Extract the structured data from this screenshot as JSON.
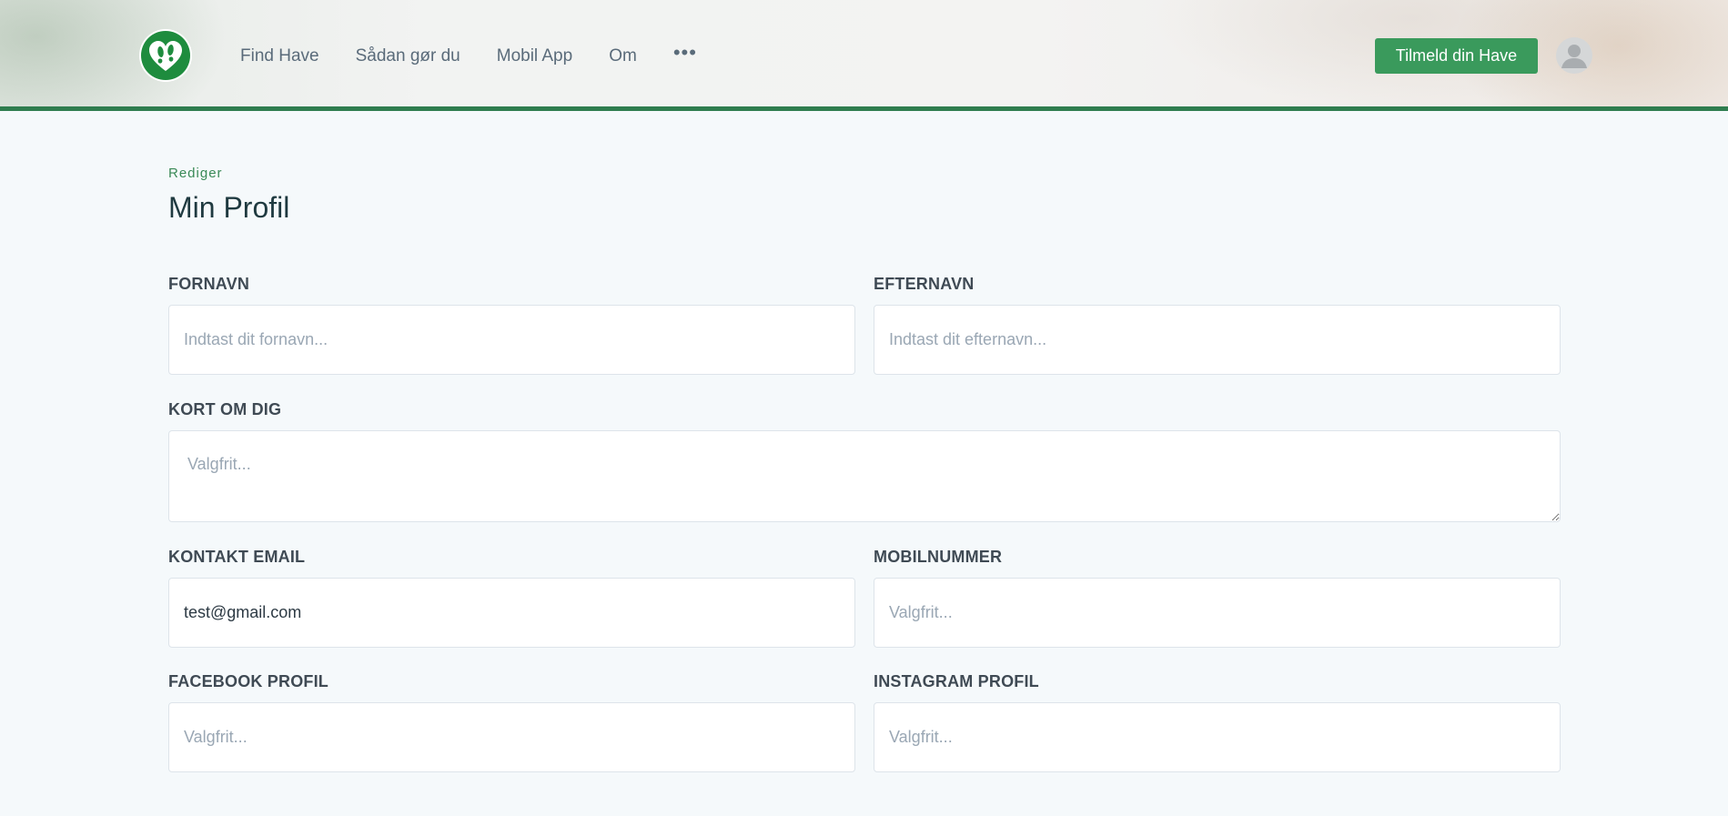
{
  "header": {
    "nav": [
      "Find Have",
      "Sådan gør du",
      "Mobil App",
      "Om"
    ],
    "more_label": "•••",
    "cta_label": "Tilmeld din Have"
  },
  "page": {
    "eyebrow": "Rediger",
    "title": "Min Profil"
  },
  "form": {
    "first_name": {
      "label": "FORNAVN",
      "value": "",
      "placeholder": "Indtast dit fornavn..."
    },
    "last_name": {
      "label": "EFTERNAVN",
      "value": "",
      "placeholder": "Indtast dit efternavn..."
    },
    "about": {
      "label": "KORT OM DIG",
      "value": "",
      "placeholder": "Valgfrit..."
    },
    "email": {
      "label": "KONTAKT EMAIL",
      "value": "test@gmail.com",
      "placeholder": ""
    },
    "mobile": {
      "label": "MOBILNUMMER",
      "value": "",
      "placeholder": "Valgfrit..."
    },
    "facebook": {
      "label": "FACEBOOK PROFIL",
      "value": "",
      "placeholder": "Valgfrit..."
    },
    "instagram": {
      "label": "INSTAGRAM PROFIL",
      "value": "",
      "placeholder": "Valgfrit..."
    }
  },
  "colors": {
    "brand": "#3a9a5c",
    "brand_dark": "#2f7d4f",
    "background": "#f5f9fb"
  }
}
